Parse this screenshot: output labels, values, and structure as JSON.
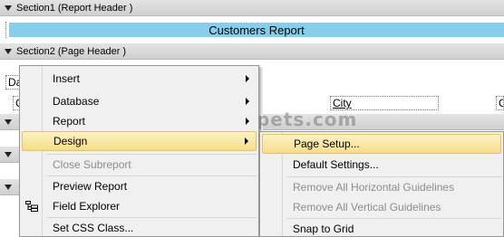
{
  "sections": {
    "section1_label": "Section1 (Report Header )",
    "section2_label": "Section2 (Page Header )"
  },
  "report": {
    "title": "Customers Report",
    "page_header_fields": [
      "Da",
      "C",
      "City",
      "C"
    ]
  },
  "watermark": "© aspsnippets.com",
  "context_menu": {
    "items": [
      {
        "label": "Insert",
        "submenu": true
      },
      {
        "label": "Database",
        "submenu": true
      },
      {
        "label": "Report",
        "submenu": true
      },
      {
        "label": "Design",
        "submenu": true
      },
      {
        "label": "Close Subreport",
        "disabled": true
      },
      {
        "label": "Preview Report"
      },
      {
        "label": "Field Explorer",
        "icon": "field-explorer-icon"
      },
      {
        "label": "Set CSS Class..."
      }
    ]
  },
  "design_submenu": {
    "items": [
      {
        "label": "Page Setup..."
      },
      {
        "label": "Default Settings..."
      },
      {
        "label": "Remove All Horizontal Guidelines",
        "disabled": true
      },
      {
        "label": "Remove All Vertical Guidelines",
        "disabled": true
      },
      {
        "label": "Snap to Grid"
      }
    ]
  },
  "colors": {
    "title_bg": "#87ceeb",
    "menu_highlight": "#f6dd8a",
    "menu_bg": "#f0f0f0"
  }
}
